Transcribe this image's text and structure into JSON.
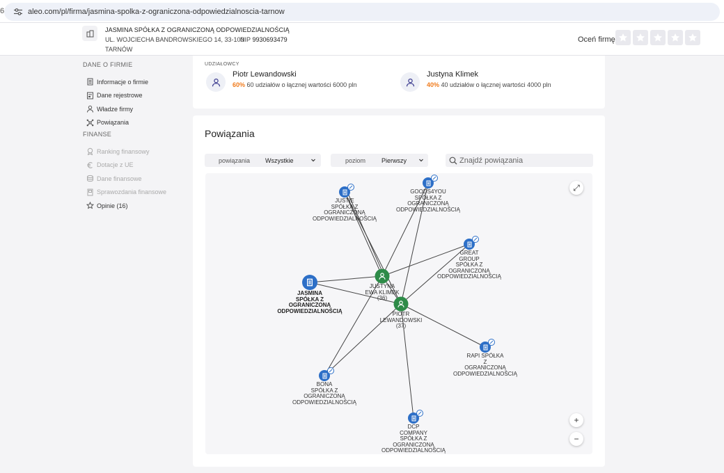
{
  "browser": {
    "left_digit": "6",
    "url": "aleo.com/pl/firma/jasmina-spolka-z-ograniczona-odpowiedzialnoscia-tarnow"
  },
  "company": {
    "name": "JASMINA SPÓŁKA Z OGRANICZONĄ ODPOWIEDZIALNOŚCIĄ",
    "address": "UL. WOJCIECHA BANDROWSKIEGO 14, 33-100",
    "nip_label": "NIP",
    "nip_value": "9930693479",
    "city": "TARNÓW",
    "rate_label": "Oceń firmę:",
    "stars": 5
  },
  "sidebar": {
    "section1": "DANE O FIRMIE",
    "items1": [
      {
        "label": "Informacje o firmie",
        "icon": "document-icon",
        "disabled": false
      },
      {
        "label": "Dane rejestrowe",
        "icon": "register-icon",
        "disabled": false
      },
      {
        "label": "Władze firmy",
        "icon": "person-icon",
        "disabled": false
      },
      {
        "label": "Powiązania",
        "icon": "network-icon",
        "disabled": false
      }
    ],
    "section2": "FINANSE",
    "items2": [
      {
        "label": "Ranking finansowy",
        "icon": "medal-icon",
        "disabled": true
      },
      {
        "label": "Dotacje z UE",
        "icon": "euro-icon",
        "disabled": true
      },
      {
        "label": "Dane finansowe",
        "icon": "coins-icon",
        "disabled": true
      },
      {
        "label": "Sprawozdania finansowe",
        "icon": "report-icon",
        "disabled": true
      },
      {
        "label": "Opinie (16)",
        "icon": "star-icon",
        "disabled": false
      }
    ]
  },
  "shareholders": {
    "label": "UDZIAŁOWCY",
    "items": [
      {
        "name": "Piotr Lewandowski",
        "pct": "60%",
        "desc": "60 udziałów o łącznej wartości 6000 pln"
      },
      {
        "name": "Justyna Klimek",
        "pct": "40%",
        "desc": "40 udziałów o łącznej wartości 4000 pln"
      }
    ]
  },
  "connections": {
    "title": "Powiązania",
    "filter1": {
      "label": "powiązania",
      "value": "Wszystkie"
    },
    "filter2": {
      "label": "poziom",
      "value": "Pierwszy"
    },
    "search_placeholder": "Znajdź powiązania",
    "colors": {
      "company": "#2d6fc7",
      "person": "#2e8b48",
      "edge": "#444444"
    },
    "nodes": [
      {
        "id": "justie",
        "type": "company",
        "label": [
          "JUSTIE",
          "SPÓŁKA Z",
          "OGRANICZONĄ",
          "ODPOWIEDZIALNOŚCIĄ"
        ]
      },
      {
        "id": "goods",
        "type": "company",
        "label": [
          "GOODS4YOU",
          "SPÓŁKA Z",
          "OGRANICZONĄ",
          "ODPOWIEDZIALNOŚCIĄ"
        ]
      },
      {
        "id": "great",
        "type": "company",
        "label": [
          "GREAT",
          "GROUP",
          "SPÓŁKA Z",
          "OGRANICZONĄ",
          "ODPOWIEDZIALNOŚCIĄ"
        ]
      },
      {
        "id": "jasmina",
        "type": "company",
        "focus": true,
        "label": [
          "JASMINA",
          "SPÓŁKA Z",
          "OGRANICZONĄ",
          "ODPOWIEDZIALNOŚCIĄ"
        ]
      },
      {
        "id": "justyna",
        "type": "person",
        "label": [
          "JUSTYNA",
          "EWA KLIMEK",
          "(36)"
        ]
      },
      {
        "id": "piotr",
        "type": "person",
        "label": [
          "PIOTR",
          "LEWANDOWSKI",
          "(37)"
        ]
      },
      {
        "id": "rapi",
        "type": "company",
        "label": [
          "RAPI SPÓŁKA",
          "Z",
          "OGRANICZONĄ",
          "ODPOWIEDZIALNOŚCIĄ"
        ]
      },
      {
        "id": "bona",
        "type": "company",
        "label": [
          "BONA",
          "SPÓŁKA Z",
          "OGRANICZONĄ",
          "ODPOWIEDZIALNOŚCIĄ"
        ]
      },
      {
        "id": "dcp",
        "type": "company",
        "label": [
          "DCP",
          "COMPANY",
          "SPÓŁKA Z",
          "OGRANICZONĄ",
          "ODPOWIEDZIALNOŚCIĄ"
        ]
      }
    ],
    "edges": [
      [
        "justie",
        "justyna"
      ],
      [
        "justie",
        "piotr"
      ],
      [
        "goods",
        "justyna"
      ],
      [
        "goods",
        "piotr"
      ],
      [
        "great",
        "justyna"
      ],
      [
        "great",
        "piotr"
      ],
      [
        "jasmina",
        "justyna"
      ],
      [
        "jasmina",
        "piotr"
      ],
      [
        "justyna",
        "bona"
      ],
      [
        "piotr",
        "bona"
      ],
      [
        "piotr",
        "rapi"
      ],
      [
        "piotr",
        "dcp"
      ],
      [
        "justyna",
        "piotr"
      ]
    ],
    "controls": {
      "expand": "⤢",
      "zoom_in": "+",
      "zoom_out": "−"
    }
  }
}
